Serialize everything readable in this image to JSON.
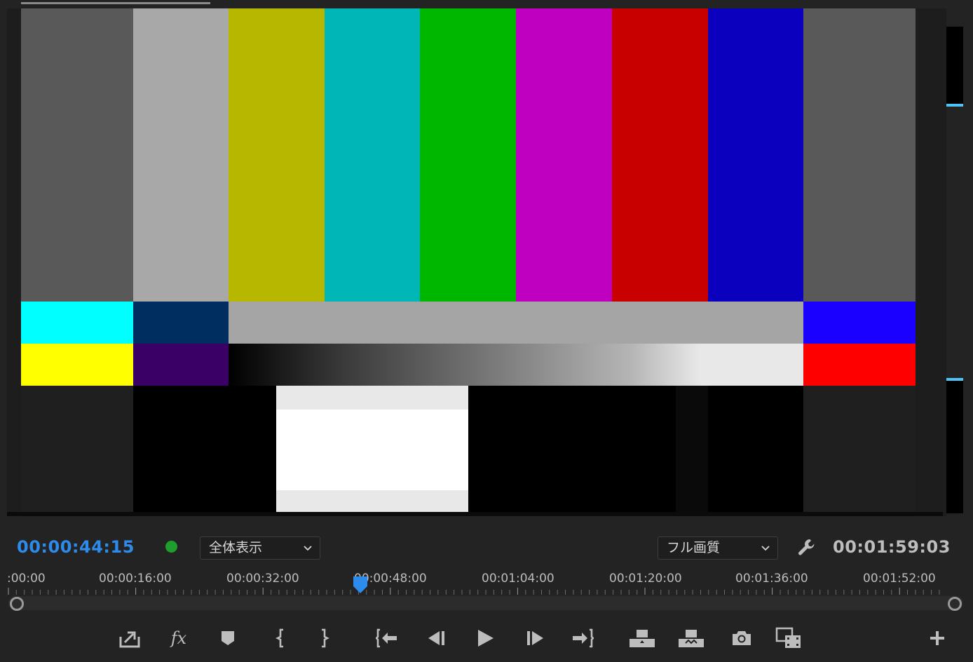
{
  "monitor": {
    "current_timecode": "00:00:44:15",
    "duration_timecode": "00:01:59:03",
    "zoom_dropdown": {
      "label": "全体表示"
    },
    "quality_dropdown": {
      "label": "フル画質"
    },
    "status_color": "#1e9e2d",
    "accent_color": "#2d8ceb"
  },
  "test_pattern": {
    "top_bar_colors": [
      "#595959",
      "#a8a8a8",
      "#b7b700",
      "#00b6b6",
      "#00b700",
      "#c000c0",
      "#c80000",
      "#0a00be",
      "#595959"
    ],
    "row2_colors": [
      "#00ffff",
      "#002e60",
      "#a5a5a5",
      "#1a00ff"
    ],
    "row3_colors": [
      "#ffff00",
      "#3a0066",
      "gradient-black-to-white",
      "#ff0000"
    ]
  },
  "ruler": {
    "labels": [
      ":00:00",
      "00:00:16:00",
      "00:00:32:00",
      "00:00:48:00",
      "00:01:04:00",
      "00:01:20:00",
      "00:01:36:00",
      "00:01:52:00"
    ]
  },
  "transport": {
    "buttons": [
      {
        "name": "export-frame-icon"
      },
      {
        "name": "fx-icon",
        "label": "fx"
      },
      {
        "name": "add-marker-icon"
      },
      {
        "name": "mark-in-icon"
      },
      {
        "name": "mark-out-icon"
      },
      {
        "name": "go-to-in-icon"
      },
      {
        "name": "step-back-icon"
      },
      {
        "name": "play-icon"
      },
      {
        "name": "step-forward-icon"
      },
      {
        "name": "go-to-out-icon"
      },
      {
        "name": "lift-icon"
      },
      {
        "name": "extract-icon"
      },
      {
        "name": "camera-icon"
      },
      {
        "name": "comparison-view-icon"
      },
      {
        "name": "add-button-icon"
      }
    ]
  }
}
